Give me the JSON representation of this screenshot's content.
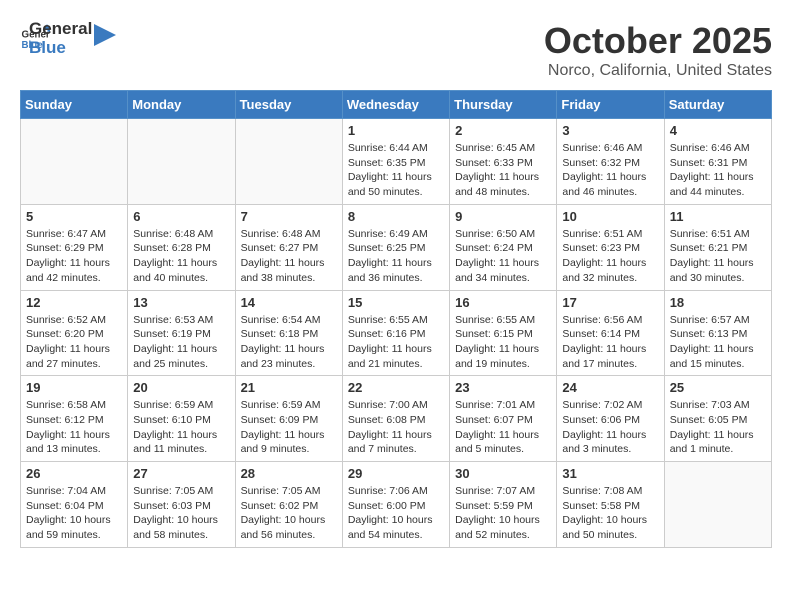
{
  "header": {
    "logo_general": "General",
    "logo_blue": "Blue",
    "month": "October 2025",
    "location": "Norco, California, United States"
  },
  "days_of_week": [
    "Sunday",
    "Monday",
    "Tuesday",
    "Wednesday",
    "Thursday",
    "Friday",
    "Saturday"
  ],
  "weeks": [
    [
      {
        "day": "",
        "info": ""
      },
      {
        "day": "",
        "info": ""
      },
      {
        "day": "",
        "info": ""
      },
      {
        "day": "1",
        "info": "Sunrise: 6:44 AM\nSunset: 6:35 PM\nDaylight: 11 hours and 50 minutes."
      },
      {
        "day": "2",
        "info": "Sunrise: 6:45 AM\nSunset: 6:33 PM\nDaylight: 11 hours and 48 minutes."
      },
      {
        "day": "3",
        "info": "Sunrise: 6:46 AM\nSunset: 6:32 PM\nDaylight: 11 hours and 46 minutes."
      },
      {
        "day": "4",
        "info": "Sunrise: 6:46 AM\nSunset: 6:31 PM\nDaylight: 11 hours and 44 minutes."
      }
    ],
    [
      {
        "day": "5",
        "info": "Sunrise: 6:47 AM\nSunset: 6:29 PM\nDaylight: 11 hours and 42 minutes."
      },
      {
        "day": "6",
        "info": "Sunrise: 6:48 AM\nSunset: 6:28 PM\nDaylight: 11 hours and 40 minutes."
      },
      {
        "day": "7",
        "info": "Sunrise: 6:48 AM\nSunset: 6:27 PM\nDaylight: 11 hours and 38 minutes."
      },
      {
        "day": "8",
        "info": "Sunrise: 6:49 AM\nSunset: 6:25 PM\nDaylight: 11 hours and 36 minutes."
      },
      {
        "day": "9",
        "info": "Sunrise: 6:50 AM\nSunset: 6:24 PM\nDaylight: 11 hours and 34 minutes."
      },
      {
        "day": "10",
        "info": "Sunrise: 6:51 AM\nSunset: 6:23 PM\nDaylight: 11 hours and 32 minutes."
      },
      {
        "day": "11",
        "info": "Sunrise: 6:51 AM\nSunset: 6:21 PM\nDaylight: 11 hours and 30 minutes."
      }
    ],
    [
      {
        "day": "12",
        "info": "Sunrise: 6:52 AM\nSunset: 6:20 PM\nDaylight: 11 hours and 27 minutes."
      },
      {
        "day": "13",
        "info": "Sunrise: 6:53 AM\nSunset: 6:19 PM\nDaylight: 11 hours and 25 minutes."
      },
      {
        "day": "14",
        "info": "Sunrise: 6:54 AM\nSunset: 6:18 PM\nDaylight: 11 hours and 23 minutes."
      },
      {
        "day": "15",
        "info": "Sunrise: 6:55 AM\nSunset: 6:16 PM\nDaylight: 11 hours and 21 minutes."
      },
      {
        "day": "16",
        "info": "Sunrise: 6:55 AM\nSunset: 6:15 PM\nDaylight: 11 hours and 19 minutes."
      },
      {
        "day": "17",
        "info": "Sunrise: 6:56 AM\nSunset: 6:14 PM\nDaylight: 11 hours and 17 minutes."
      },
      {
        "day": "18",
        "info": "Sunrise: 6:57 AM\nSunset: 6:13 PM\nDaylight: 11 hours and 15 minutes."
      }
    ],
    [
      {
        "day": "19",
        "info": "Sunrise: 6:58 AM\nSunset: 6:12 PM\nDaylight: 11 hours and 13 minutes."
      },
      {
        "day": "20",
        "info": "Sunrise: 6:59 AM\nSunset: 6:10 PM\nDaylight: 11 hours and 11 minutes."
      },
      {
        "day": "21",
        "info": "Sunrise: 6:59 AM\nSunset: 6:09 PM\nDaylight: 11 hours and 9 minutes."
      },
      {
        "day": "22",
        "info": "Sunrise: 7:00 AM\nSunset: 6:08 PM\nDaylight: 11 hours and 7 minutes."
      },
      {
        "day": "23",
        "info": "Sunrise: 7:01 AM\nSunset: 6:07 PM\nDaylight: 11 hours and 5 minutes."
      },
      {
        "day": "24",
        "info": "Sunrise: 7:02 AM\nSunset: 6:06 PM\nDaylight: 11 hours and 3 minutes."
      },
      {
        "day": "25",
        "info": "Sunrise: 7:03 AM\nSunset: 6:05 PM\nDaylight: 11 hours and 1 minute."
      }
    ],
    [
      {
        "day": "26",
        "info": "Sunrise: 7:04 AM\nSunset: 6:04 PM\nDaylight: 10 hours and 59 minutes."
      },
      {
        "day": "27",
        "info": "Sunrise: 7:05 AM\nSunset: 6:03 PM\nDaylight: 10 hours and 58 minutes."
      },
      {
        "day": "28",
        "info": "Sunrise: 7:05 AM\nSunset: 6:02 PM\nDaylight: 10 hours and 56 minutes."
      },
      {
        "day": "29",
        "info": "Sunrise: 7:06 AM\nSunset: 6:00 PM\nDaylight: 10 hours and 54 minutes."
      },
      {
        "day": "30",
        "info": "Sunrise: 7:07 AM\nSunset: 5:59 PM\nDaylight: 10 hours and 52 minutes."
      },
      {
        "day": "31",
        "info": "Sunrise: 7:08 AM\nSunset: 5:58 PM\nDaylight: 10 hours and 50 minutes."
      },
      {
        "day": "",
        "info": ""
      }
    ]
  ]
}
